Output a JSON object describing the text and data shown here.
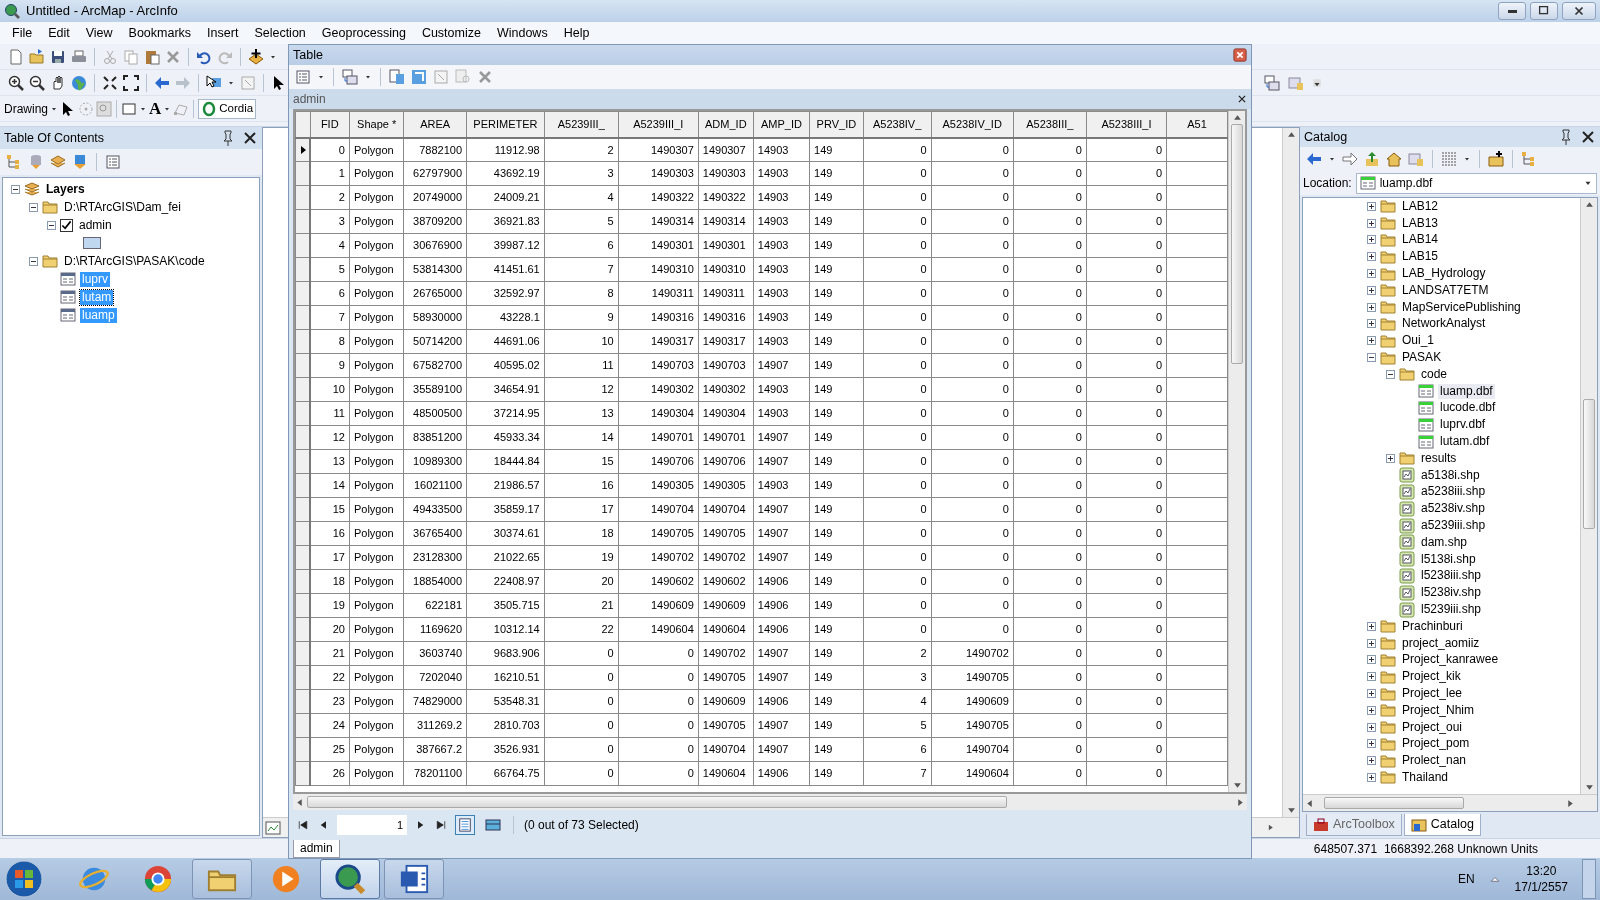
{
  "window": {
    "title": "Untitled - ArcMap - ArcInfo"
  },
  "menu": [
    "File",
    "Edit",
    "View",
    "Bookmarks",
    "Insert",
    "Selection",
    "Geoprocessing",
    "Customize",
    "Windows",
    "Help"
  ],
  "drawing_toolbar": {
    "label": "Drawing",
    "text_tool": "A",
    "font": "Cordia"
  },
  "toc": {
    "title": "Table Of Contents",
    "tree": [
      {
        "label": "Layers",
        "kind": "data_frame",
        "expanded": true,
        "selected": false,
        "children": [
          {
            "label": "D:\\RTArcGIS\\Dam_fei",
            "kind": "folder",
            "expanded": true,
            "selected": false,
            "children": [
              {
                "label": "admin",
                "kind": "layer",
                "expanded": true,
                "checked": true,
                "selected": false
              }
            ]
          },
          {
            "label": "D:\\RTArcGIS\\PASAK\\code",
            "kind": "folder",
            "expanded": true,
            "selected": false,
            "children": [
              {
                "label": "luprv",
                "kind": "table",
                "selected": true,
                "focused": false
              },
              {
                "label": "lutam",
                "kind": "table",
                "selected": true,
                "focused": true
              },
              {
                "label": "luamp",
                "kind": "table",
                "selected": true,
                "focused": false
              }
            ]
          }
        ]
      }
    ]
  },
  "table_window": {
    "title": "Table",
    "table_name": "admin",
    "columns": [
      {
        "label": "FID",
        "kind": "number"
      },
      {
        "label": "Shape *",
        "kind": "text"
      },
      {
        "label": "AREA",
        "kind": "number"
      },
      {
        "label": "PERIMETER",
        "kind": "number"
      },
      {
        "label": "A5239III_",
        "kind": "number"
      },
      {
        "label": "A5239III_I",
        "kind": "number"
      },
      {
        "label": "ADM_ID",
        "kind": "text"
      },
      {
        "label": "AMP_ID",
        "kind": "text"
      },
      {
        "label": "PRV_ID",
        "kind": "text"
      },
      {
        "label": "A5238IV_",
        "kind": "number"
      },
      {
        "label": "A5238IV_ID",
        "kind": "number"
      },
      {
        "label": "A5238III_",
        "kind": "number"
      },
      {
        "label": "A5238III_I",
        "kind": "number"
      },
      {
        "label": "A51",
        "kind": "number"
      }
    ],
    "rows": [
      {
        "current": true,
        "cells": [
          "0",
          "Polygon",
          "7882100",
          "11912.98",
          "2",
          "1490307",
          "1490307",
          "14903",
          "149",
          "0",
          "0",
          "0",
          "0"
        ]
      },
      {
        "current": false,
        "cells": [
          "1",
          "Polygon",
          "62797900",
          "43692.19",
          "3",
          "1490303",
          "1490303",
          "14903",
          "149",
          "0",
          "0",
          "0",
          "0"
        ]
      },
      {
        "current": false,
        "cells": [
          "2",
          "Polygon",
          "20749000",
          "24009.21",
          "4",
          "1490322",
          "1490322",
          "14903",
          "149",
          "0",
          "0",
          "0",
          "0"
        ]
      },
      {
        "current": false,
        "cells": [
          "3",
          "Polygon",
          "38709200",
          "36921.83",
          "5",
          "1490314",
          "1490314",
          "14903",
          "149",
          "0",
          "0",
          "0",
          "0"
        ]
      },
      {
        "current": false,
        "cells": [
          "4",
          "Polygon",
          "30676900",
          "39987.12",
          "6",
          "1490301",
          "1490301",
          "14903",
          "149",
          "0",
          "0",
          "0",
          "0"
        ]
      },
      {
        "current": false,
        "cells": [
          "5",
          "Polygon",
          "53814300",
          "41451.61",
          "7",
          "1490310",
          "1490310",
          "14903",
          "149",
          "0",
          "0",
          "0",
          "0"
        ]
      },
      {
        "current": false,
        "cells": [
          "6",
          "Polygon",
          "26765000",
          "32592.97",
          "8",
          "1490311",
          "1490311",
          "14903",
          "149",
          "0",
          "0",
          "0",
          "0"
        ]
      },
      {
        "current": false,
        "cells": [
          "7",
          "Polygon",
          "58930000",
          "43228.1",
          "9",
          "1490316",
          "1490316",
          "14903",
          "149",
          "0",
          "0",
          "0",
          "0"
        ]
      },
      {
        "current": false,
        "cells": [
          "8",
          "Polygon",
          "50714200",
          "44691.06",
          "10",
          "1490317",
          "1490317",
          "14903",
          "149",
          "0",
          "0",
          "0",
          "0"
        ]
      },
      {
        "current": false,
        "cells": [
          "9",
          "Polygon",
          "67582700",
          "40595.02",
          "11",
          "1490703",
          "1490703",
          "14907",
          "149",
          "0",
          "0",
          "0",
          "0"
        ]
      },
      {
        "current": false,
        "cells": [
          "10",
          "Polygon",
          "35589100",
          "34654.91",
          "12",
          "1490302",
          "1490302",
          "14903",
          "149",
          "0",
          "0",
          "0",
          "0"
        ]
      },
      {
        "current": false,
        "cells": [
          "11",
          "Polygon",
          "48500500",
          "37214.95",
          "13",
          "1490304",
          "1490304",
          "14903",
          "149",
          "0",
          "0",
          "0",
          "0"
        ]
      },
      {
        "current": false,
        "cells": [
          "12",
          "Polygon",
          "83851200",
          "45933.34",
          "14",
          "1490701",
          "1490701",
          "14907",
          "149",
          "0",
          "0",
          "0",
          "0"
        ]
      },
      {
        "current": false,
        "cells": [
          "13",
          "Polygon",
          "10989300",
          "18444.84",
          "15",
          "1490706",
          "1490706",
          "14907",
          "149",
          "0",
          "0",
          "0",
          "0"
        ]
      },
      {
        "current": false,
        "cells": [
          "14",
          "Polygon",
          "16021100",
          "21986.57",
          "16",
          "1490305",
          "1490305",
          "14903",
          "149",
          "0",
          "0",
          "0",
          "0"
        ]
      },
      {
        "current": false,
        "cells": [
          "15",
          "Polygon",
          "49433500",
          "35859.17",
          "17",
          "1490704",
          "1490704",
          "14907",
          "149",
          "0",
          "0",
          "0",
          "0"
        ]
      },
      {
        "current": false,
        "cells": [
          "16",
          "Polygon",
          "36765400",
          "30374.61",
          "18",
          "1490705",
          "1490705",
          "14907",
          "149",
          "0",
          "0",
          "0",
          "0"
        ]
      },
      {
        "current": false,
        "cells": [
          "17",
          "Polygon",
          "23128300",
          "21022.65",
          "19",
          "1490702",
          "1490702",
          "14907",
          "149",
          "0",
          "0",
          "0",
          "0"
        ]
      },
      {
        "current": false,
        "cells": [
          "18",
          "Polygon",
          "18854000",
          "22408.97",
          "20",
          "1490602",
          "1490602",
          "14906",
          "149",
          "0",
          "0",
          "0",
          "0"
        ]
      },
      {
        "current": false,
        "cells": [
          "19",
          "Polygon",
          "622181",
          "3505.715",
          "21",
          "1490609",
          "1490609",
          "14906",
          "149",
          "0",
          "0",
          "0",
          "0"
        ]
      },
      {
        "current": false,
        "cells": [
          "20",
          "Polygon",
          "1169620",
          "10312.14",
          "22",
          "1490604",
          "1490604",
          "14906",
          "149",
          "0",
          "0",
          "0",
          "0"
        ]
      },
      {
        "current": false,
        "cells": [
          "21",
          "Polygon",
          "3603740",
          "9683.906",
          "0",
          "0",
          "1490702",
          "14907",
          "149",
          "2",
          "1490702",
          "0",
          "0"
        ]
      },
      {
        "current": false,
        "cells": [
          "22",
          "Polygon",
          "7202040",
          "16210.51",
          "0",
          "0",
          "1490705",
          "14907",
          "149",
          "3",
          "1490705",
          "0",
          "0"
        ]
      },
      {
        "current": false,
        "cells": [
          "23",
          "Polygon",
          "74829000",
          "53548.31",
          "0",
          "0",
          "1490609",
          "14906",
          "149",
          "4",
          "1490609",
          "0",
          "0"
        ]
      },
      {
        "current": false,
        "cells": [
          "24",
          "Polygon",
          "311269.2",
          "2810.703",
          "0",
          "0",
          "1490705",
          "14907",
          "149",
          "5",
          "1490705",
          "0",
          "0"
        ]
      },
      {
        "current": false,
        "cells": [
          "25",
          "Polygon",
          "387667.2",
          "3526.931",
          "0",
          "0",
          "1490704",
          "14907",
          "149",
          "6",
          "1490704",
          "0",
          "0"
        ]
      },
      {
        "current": false,
        "cells": [
          "26",
          "Polygon",
          "78201100",
          "66764.75",
          "0",
          "0",
          "1490604",
          "14906",
          "149",
          "7",
          "1490604",
          "0",
          "0"
        ]
      }
    ],
    "page": "1",
    "view_modes": [
      {
        "kind": "all",
        "selected": true
      },
      {
        "kind": "selected_only",
        "selected": false
      }
    ],
    "selection_status": "(0 out of 73 Selected)",
    "tabs": [
      {
        "label": "admin",
        "selected": true
      }
    ]
  },
  "catalog": {
    "title": "Catalog",
    "location_label": "Location:",
    "location": "luamp.dbf",
    "tree": [
      {
        "label": "LAB12",
        "kind": "folder",
        "expanded": false,
        "selected": false
      },
      {
        "label": "LAB13",
        "kind": "folder",
        "expanded": false,
        "selected": false
      },
      {
        "label": "LAB14",
        "kind": "folder",
        "expanded": false,
        "selected": false
      },
      {
        "label": "LAB15",
        "kind": "folder",
        "expanded": false,
        "selected": false
      },
      {
        "label": "LAB_Hydrology",
        "kind": "folder",
        "expanded": false,
        "selected": false
      },
      {
        "label": "LANDSAT7ETM",
        "kind": "folder",
        "expanded": false,
        "selected": false
      },
      {
        "label": "MapServicePublishing",
        "kind": "folder",
        "expanded": false,
        "selected": false
      },
      {
        "label": "NetworkAnalyst",
        "kind": "folder",
        "expanded": false,
        "selected": false
      },
      {
        "label": "Oui_1",
        "kind": "folder",
        "expanded": false,
        "selected": false
      },
      {
        "label": "PASAK",
        "kind": "folder",
        "expanded": true,
        "selected": false,
        "children": [
          {
            "label": "code",
            "kind": "folder",
            "expanded": true,
            "selected": false,
            "children": [
              {
                "label": "luamp.dbf",
                "kind": "table",
                "selected": true
              },
              {
                "label": "lucode.dbf",
                "kind": "table",
                "selected": false
              },
              {
                "label": "luprv.dbf",
                "kind": "table",
                "selected": false
              },
              {
                "label": "lutam.dbf",
                "kind": "table",
                "selected": false
              }
            ]
          },
          {
            "label": "results",
            "kind": "folder",
            "expanded": false,
            "selected": false
          },
          {
            "label": "a5138i.shp",
            "kind": "shapefile",
            "selected": false
          },
          {
            "label": "a5238iii.shp",
            "kind": "shapefile",
            "selected": false
          },
          {
            "label": "a5238iv.shp",
            "kind": "shapefile",
            "selected": false
          },
          {
            "label": "a5239iii.shp",
            "kind": "shapefile",
            "selected": false
          },
          {
            "label": "dam.shp",
            "kind": "shapefile",
            "selected": false
          },
          {
            "label": "l5138i.shp",
            "kind": "shapefile",
            "selected": false
          },
          {
            "label": "l5238iii.shp",
            "kind": "shapefile",
            "selected": false
          },
          {
            "label": "l5238iv.shp",
            "kind": "shapefile",
            "selected": false
          },
          {
            "label": "l5239iii.shp",
            "kind": "shapefile",
            "selected": false
          }
        ]
      },
      {
        "label": "Prachinburi",
        "kind": "folder",
        "expanded": false,
        "selected": false
      },
      {
        "label": "project_aomiiz",
        "kind": "folder",
        "expanded": false,
        "selected": false
      },
      {
        "label": "Project_kanrawee",
        "kind": "folder",
        "expanded": false,
        "selected": false
      },
      {
        "label": "Project_kik",
        "kind": "folder",
        "expanded": false,
        "selected": false
      },
      {
        "label": "Project_lee",
        "kind": "folder",
        "expanded": false,
        "selected": false
      },
      {
        "label": "Project_Nhim",
        "kind": "folder",
        "expanded": false,
        "selected": false
      },
      {
        "label": "Project_oui",
        "kind": "folder",
        "expanded": false,
        "selected": false
      },
      {
        "label": "Project_pom",
        "kind": "folder",
        "expanded": false,
        "selected": false
      },
      {
        "label": "Prolect_nan",
        "kind": "folder",
        "expanded": false,
        "selected": false
      },
      {
        "label": "Thailand",
        "kind": "folder",
        "expanded": false,
        "selected": false
      }
    ],
    "tabs": [
      {
        "label": "ArcToolbox",
        "kind": "toolbox",
        "selected": false
      },
      {
        "label": "Catalog",
        "kind": "catalog",
        "selected": true
      }
    ]
  },
  "status_bar": {
    "coordinates": "648507.371  1668392.268 Unknown Units"
  },
  "taskbar": {
    "apps": [
      {
        "kind": "ie",
        "running": false,
        "active": false
      },
      {
        "kind": "chrome",
        "running": false,
        "active": false
      },
      {
        "kind": "explorer",
        "running": true,
        "active": false
      },
      {
        "kind": "media",
        "running": false,
        "active": false
      },
      {
        "kind": "arcmap",
        "running": true,
        "active": true
      },
      {
        "kind": "word",
        "running": true,
        "active": false
      }
    ],
    "language": "EN",
    "time": "13:20",
    "date": "17/1/2557"
  }
}
